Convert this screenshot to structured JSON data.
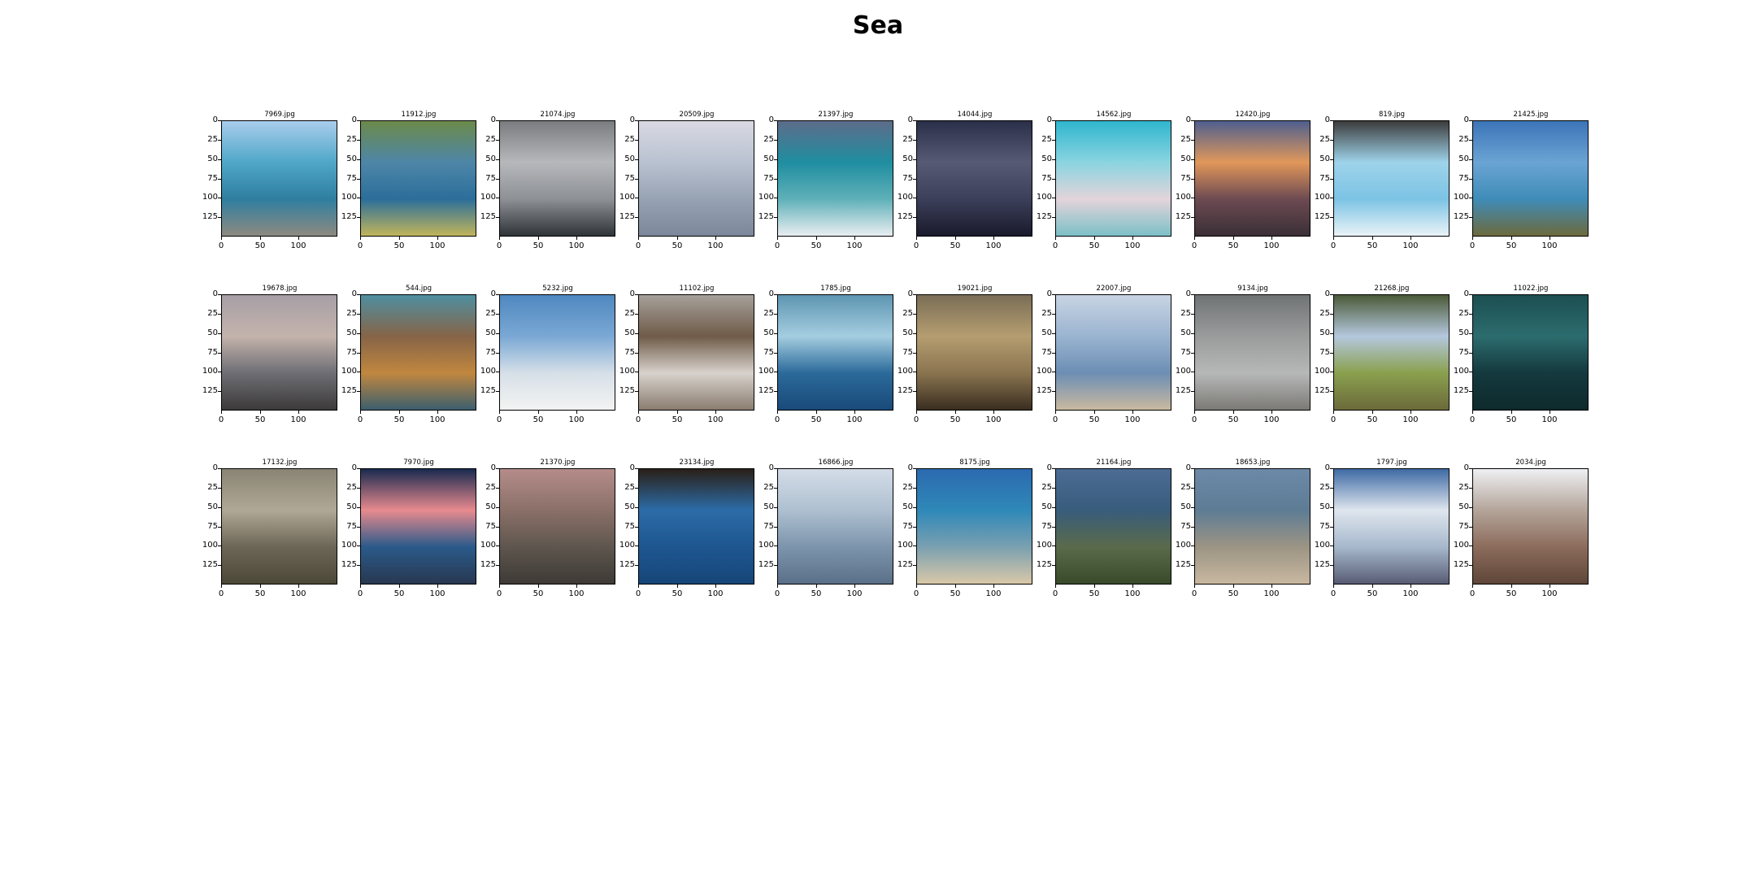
{
  "chart_data": {
    "type": "image-grid",
    "title": "Sea",
    "rows": 3,
    "cols": 10,
    "image_extent": [
      0,
      150
    ],
    "xticks": [
      "0",
      "50",
      "100"
    ],
    "yticks": [
      "0",
      "25",
      "50",
      "75",
      "100",
      "125"
    ],
    "panels": [
      {
        "title": "7969.jpg",
        "scene": [
          "#a9cdec",
          "#4fa7c8",
          "#2f7ea0",
          "#8d8a80"
        ]
      },
      {
        "title": "11912.jpg",
        "scene": [
          "#6c8a4a",
          "#4e86a8",
          "#2b6e9a",
          "#c1b45a"
        ]
      },
      {
        "title": "21074.jpg",
        "scene": [
          "#7a7c80",
          "#b6b8bc",
          "#8d9094",
          "#2f3438"
        ]
      },
      {
        "title": "20509.jpg",
        "scene": [
          "#d9d9e3",
          "#b9c2d1",
          "#97a2b3",
          "#7c879b"
        ]
      },
      {
        "title": "21397.jpg",
        "scene": [
          "#5d6c8a",
          "#1f8ea0",
          "#5fb0b8",
          "#e9eef1"
        ]
      },
      {
        "title": "14044.jpg",
        "scene": [
          "#2a2f4a",
          "#575a74",
          "#3c3f5a",
          "#191a2b"
        ]
      },
      {
        "title": "14562.jpg",
        "scene": [
          "#2fb6cf",
          "#8ad4e0",
          "#e3d4da",
          "#7cc0c8"
        ]
      },
      {
        "title": "12420.jpg",
        "scene": [
          "#4e5f8f",
          "#e1975a",
          "#6d4a52",
          "#3a2f36"
        ]
      },
      {
        "title": "819.jpg",
        "scene": [
          "#3c3c3c",
          "#9ed3ea",
          "#7cc3e4",
          "#eaf3f7"
        ]
      },
      {
        "title": "21425.jpg",
        "scene": [
          "#3c74b8",
          "#6aa4d4",
          "#3f8cb8",
          "#6c6a3c"
        ]
      },
      {
        "title": "19678.jpg",
        "scene": [
          "#a69fa6",
          "#c4b3ac",
          "#6e6e74",
          "#3c3a3a"
        ]
      },
      {
        "title": "544.jpg",
        "scene": [
          "#4f8fa1",
          "#866447",
          "#c1873f",
          "#3c5f6e"
        ]
      },
      {
        "title": "5232.jpg",
        "scene": [
          "#4f88c0",
          "#7aa8d4",
          "#d6dfe8",
          "#f3f3f2"
        ]
      },
      {
        "title": "11102.jpg",
        "scene": [
          "#a6a09a",
          "#6f5b49",
          "#d8d2cc",
          "#8a7d70"
        ]
      },
      {
        "title": "1785.jpg",
        "scene": [
          "#5e96b2",
          "#a4cde0",
          "#2b6a9a",
          "#194a7a"
        ]
      },
      {
        "title": "19021.jpg",
        "scene": [
          "#7a6e56",
          "#b59d70",
          "#8a7450",
          "#3a2e20"
        ]
      },
      {
        "title": "22007.jpg",
        "scene": [
          "#c8d4e4",
          "#9ab4d0",
          "#6c8eb4",
          "#c9b9a0"
        ]
      },
      {
        "title": "9134.jpg",
        "scene": [
          "#707374",
          "#9a9c9c",
          "#b6b8b8",
          "#7c7a76"
        ]
      },
      {
        "title": "21268.jpg",
        "scene": [
          "#4b5a38",
          "#b4c8de",
          "#8aa04e",
          "#6b6a3a"
        ]
      },
      {
        "title": "11022.jpg",
        "scene": [
          "#1c4f52",
          "#2c6c6e",
          "#14393e",
          "#0e2a2c"
        ]
      },
      {
        "title": "17132.jpg",
        "scene": [
          "#8a8474",
          "#b0a896",
          "#6c6656",
          "#4c4838"
        ]
      },
      {
        "title": "7970.jpg",
        "scene": [
          "#1a2a50",
          "#e88a8e",
          "#2a5a8a",
          "#283850"
        ]
      },
      {
        "title": "21370.jpg",
        "scene": [
          "#b58c8a",
          "#8a7068",
          "#5e564e",
          "#3e3a36"
        ]
      },
      {
        "title": "23134.jpg",
        "scene": [
          "#2a2018",
          "#2c6ca8",
          "#1e5690",
          "#164678"
        ]
      },
      {
        "title": "16866.jpg",
        "scene": [
          "#d4dce8",
          "#aec0d0",
          "#7c94ac",
          "#5a7088"
        ]
      },
      {
        "title": "8175.jpg",
        "scene": [
          "#2c6ab0",
          "#2e88b8",
          "#7aa0b0",
          "#d9c8a8"
        ]
      },
      {
        "title": "21164.jpg",
        "scene": [
          "#4c6c94",
          "#385c7c",
          "#5a6a4a",
          "#384a2a"
        ]
      },
      {
        "title": "18653.jpg",
        "scene": [
          "#6c8aa8",
          "#5e7c94",
          "#9c9484",
          "#c8b8a0"
        ]
      },
      {
        "title": "1797.jpg",
        "scene": [
          "#3e6aa4",
          "#dfe6ee",
          "#a6b8cc",
          "#585c74"
        ]
      },
      {
        "title": "2034.jpg",
        "scene": [
          "#eef0f2",
          "#b4a49a",
          "#8c6c5c",
          "#5e4638"
        ]
      }
    ]
  }
}
